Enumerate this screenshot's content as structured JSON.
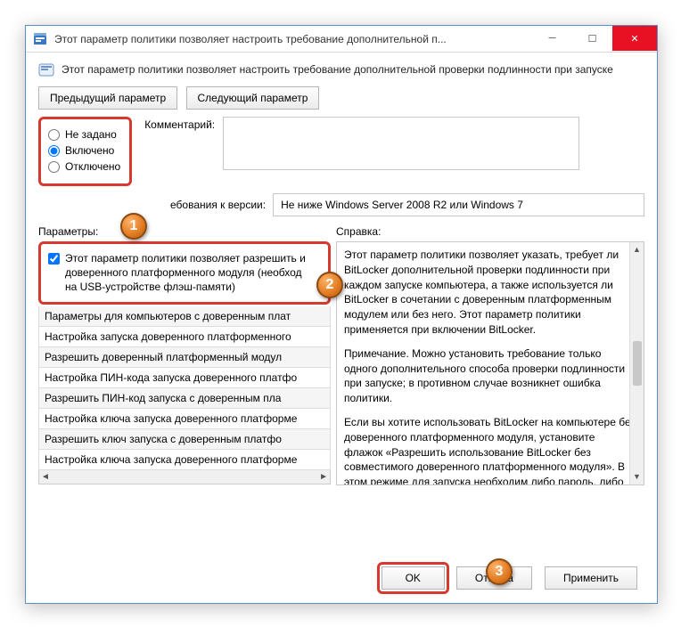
{
  "title": "Этот параметр политики позволяет настроить требование дополнительной п...",
  "description": "Этот параметр политики позволяет настроить требование дополнительной проверки подлинности при запуске",
  "nav": {
    "prev": "Предыдущий параметр",
    "next": "Следующий параметр"
  },
  "state": {
    "not_configured": "Не задано",
    "enabled": "Включено",
    "disabled": "Отключено"
  },
  "comment_label": "Комментарий:",
  "version_label": "ебования к версии:",
  "version_value": "Не ниже Windows Server 2008 R2 или Windows 7",
  "params_header": "Параметры:",
  "help_header": "Справка:",
  "option_check": {
    "l1": "Этот параметр политики позволяет разрешить и",
    "l2": "доверенного платформенного модуля (необход",
    "l3": "на USB-устройстве флэш-памяти)"
  },
  "opt_items": [
    "Параметры для компьютеров с доверенным плат",
    "Настройка запуска доверенного платформенного",
    "Разрешить доверенный платформенный модул",
    "Настройка ПИН-кода запуска доверенного платфо",
    "Разрешить ПИН-код запуска с доверенным пла",
    "Настройка ключа запуска доверенного платформе",
    "Разрешить ключ запуска с доверенным платфо",
    "Настройка ключа запуска доверенного платформе"
  ],
  "help": {
    "p1": "Этот параметр политики позволяет указать, требует ли BitLocker дополнительной проверки подлинности при каждом запуске компьютера, а также используется ли BitLocker в сочетании с доверенным платформенным модулем или без него. Этот параметр политики применяется при включении BitLocker.",
    "p2": "Примечание. Можно установить требование только одного дополнительного способа проверки подлинности при запуске; в противном случае возникнет ошибка политики.",
    "p3": "Если вы хотите использовать BitLocker на компьютере без доверенного платформенного модуля, установите флажок «Разрешить использование BitLocker без совместимого доверенного платформенного модуля». В этом режиме для запуска необходим либо пароль, либо USB-накопитель. При использовании ключа запуска ключевые сведения, применяемые для шифрования диска, хранятся на USB-"
  },
  "buttons": {
    "ok": "OK",
    "cancel": "Отмена",
    "apply": "Применить"
  },
  "badges": {
    "b1": "1",
    "b2": "2",
    "b3": "3"
  }
}
